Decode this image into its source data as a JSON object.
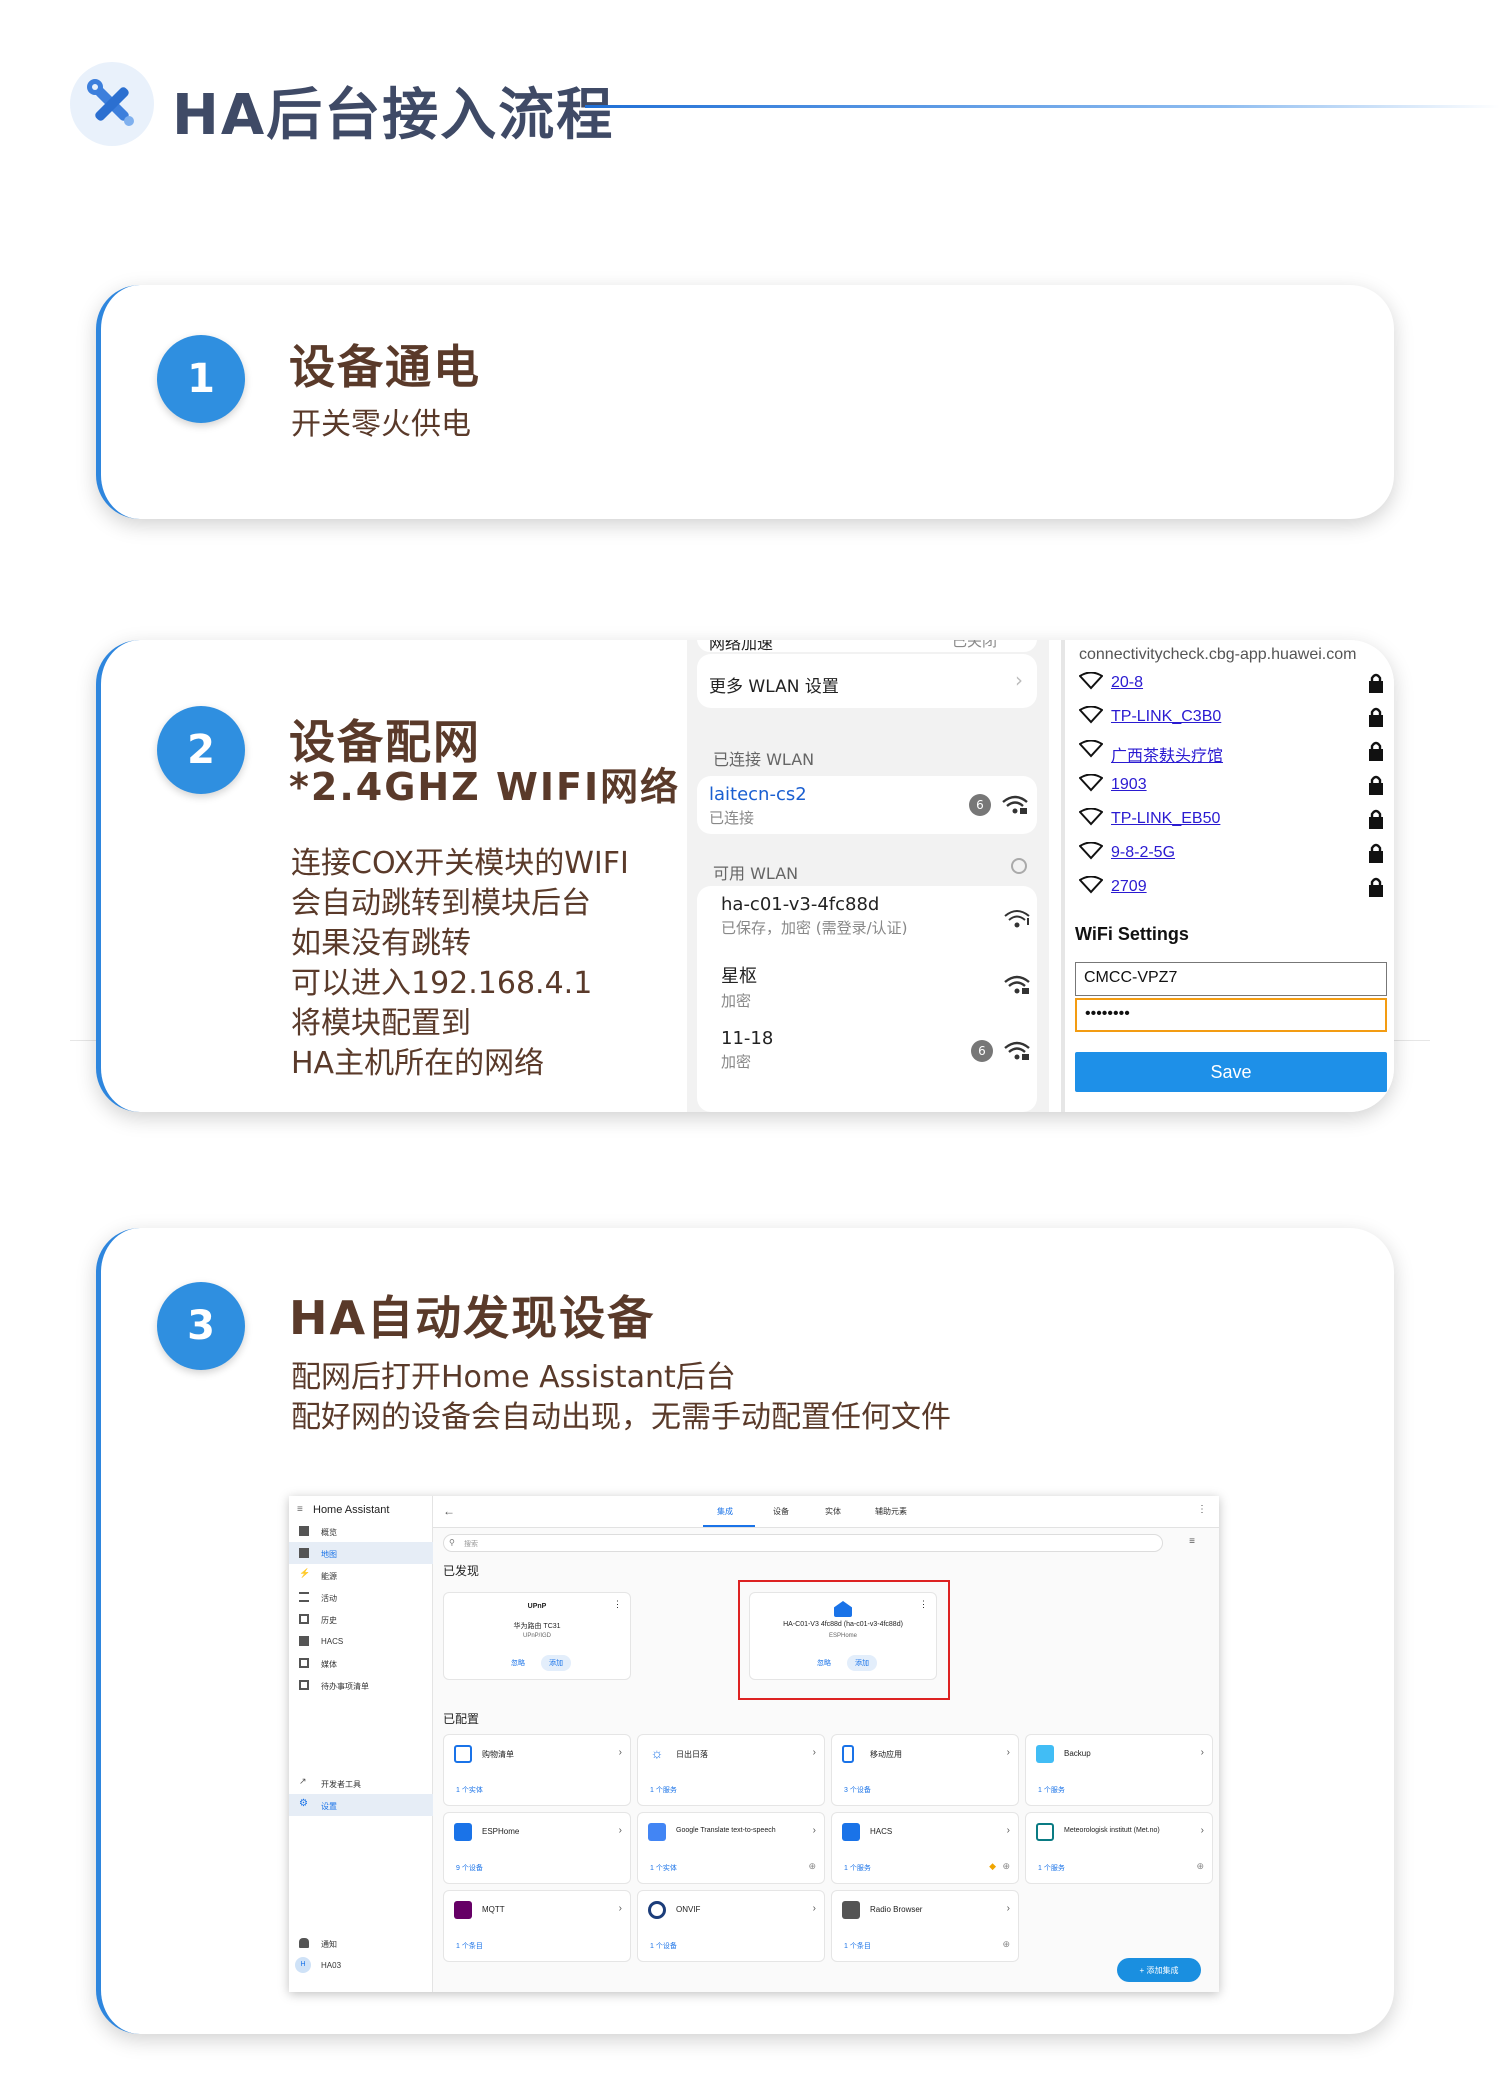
{
  "header": {
    "title": "HA后台接入流程",
    "logo_icon": "tools-icon"
  },
  "steps": [
    {
      "number": "1",
      "title": "设备通电",
      "desc_lines": [
        "开关零火供电"
      ]
    },
    {
      "number": "2",
      "title": "设备配网",
      "subtitle": "*2.4GHZ WIFI网络",
      "desc_lines": [
        "连接COX开关模块的WIFI",
        "会自动跳转到模块后台",
        "如果没有跳转",
        "可以进入192.168.4.1",
        "将模块配置到",
        "HA主机所在的网络"
      ]
    },
    {
      "number": "3",
      "title": "HA自动发现设备",
      "desc_lines": [
        "配网后打开Home Assistant后台",
        "配好网的设备会自动出现，无需手动配置任何文件"
      ]
    }
  ],
  "phone": {
    "top_cut": "网络加速",
    "top_cut_right": "已关闭",
    "more_settings": "更多 WLAN 设置",
    "connected_label": "已连接 WLAN",
    "connected": {
      "name": "laitecn-cs2",
      "status": "已连接"
    },
    "available_label": "可用 WLAN",
    "networks": [
      {
        "name": "ha-c01-v3-4fc88d",
        "status": "已保存，加密 (需登录/认证)"
      },
      {
        "name": "星枢",
        "status": "加密"
      },
      {
        "name": "11-18",
        "status": "加密"
      }
    ]
  },
  "router": {
    "url": "connectivitycheck.cbg-app.huawei.com",
    "networks": [
      "20-8",
      "TP-LINK_C3B0",
      "广西茶麸头疗馆",
      "1903",
      "TP-LINK_EB50",
      "9-8-2-5G",
      "2709"
    ],
    "settings_title": "WiFi Settings",
    "ssid_value": "CMCC-VPZ7",
    "password_value": "••••••••",
    "save_label": "Save"
  },
  "ha": {
    "app_title": "Home Assistant",
    "sidebar": [
      "概览",
      "地图",
      "能源",
      "活动",
      "历史",
      "HACS",
      "媒体",
      "待办事项清单"
    ],
    "sidebar_bottom": [
      "开发者工具",
      "设置"
    ],
    "sidebar_footer": [
      "通知",
      "HA03"
    ],
    "avatar_letter": "H",
    "tabs": [
      "集成",
      "设备",
      "实体",
      "辅助元素"
    ],
    "search_placeholder": "搜索",
    "discovered_label": "已发现",
    "configured_label": "已配置",
    "discovered": [
      {
        "brand": "UPnP",
        "name": "华为路由 TC31",
        "sub": "UPnP/IGD",
        "ignore": "忽略",
        "add": "添加"
      },
      {
        "brand": "",
        "name": "HA-C01-V3 4fc88d (ha-c01-v3-4fc88d)",
        "sub": "ESPHome",
        "ignore": "忽略",
        "add": "添加"
      }
    ],
    "integrations": [
      {
        "name": "购物清单",
        "count": "1 个实体",
        "color": "#1a73e8"
      },
      {
        "name": "日出日落",
        "count": "1 个服务",
        "color": "#1a73e8"
      },
      {
        "name": "移动应用",
        "count": "3 个设备",
        "color": "#1a73e8"
      },
      {
        "name": "Backup",
        "count": "1 个服务",
        "color": "#41bdf5"
      },
      {
        "name": "ESPHome",
        "count": "9 个设备",
        "color": "#1a73e8"
      },
      {
        "name": "Google Translate text-to-speech",
        "count": "1 个实体",
        "color": "#4285f4"
      },
      {
        "name": "HACS",
        "count": "1 个服务",
        "color": "#1a73e8"
      },
      {
        "name": "Meteorologisk institutt (Met.no)",
        "count": "1 个服务",
        "color": "#0a7b83"
      },
      {
        "name": "MQTT",
        "count": "1 个条目",
        "color": "#660066"
      },
      {
        "name": "ONVIF",
        "count": "1 个设备",
        "color": "#1c3d7a"
      },
      {
        "name": "Radio Browser",
        "count": "1 个条目",
        "color": "#555555"
      }
    ],
    "fab_label": "+ 添加集成"
  },
  "colors": {
    "accent": "#2f8fe0",
    "title_brown": "#5a3a2a",
    "header_title": "#3f4a66",
    "highlight_red": "#dd2222"
  }
}
